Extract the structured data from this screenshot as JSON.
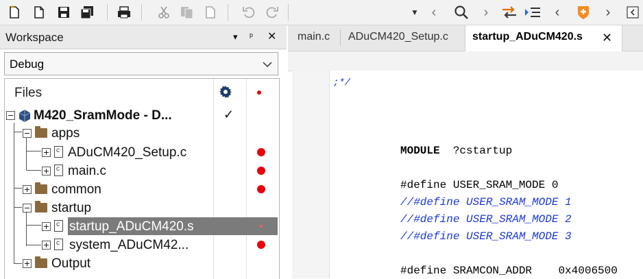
{
  "workspace": {
    "title": "Workspace",
    "pin": "▾",
    "pin2": "ᵖ",
    "close": "✕",
    "config": "Debug",
    "files_header": "Files"
  },
  "tree": {
    "project": "M420_SramMode - D...",
    "project_check": "✓",
    "apps": "apps",
    "setup_file": "ADuCM420_Setup.c",
    "main_file": "main.c",
    "common": "common",
    "startup": "startup",
    "startup_file": "startup_ADuCM420.s",
    "system_file": "system_ADuCM42...",
    "output": "Output"
  },
  "tabs": {
    "tab1": "main.c",
    "tab2": "ADuCM420_Setup.c",
    "active": "startup_ADuCM420.s",
    "close": "✕"
  },
  "code": {
    "line1": ";*/",
    "line2": "MODULE  ?cstartup",
    "line3": "#define USER_SRAM_MODE 0",
    "line4": "//#define USER_SRAM_MODE 1",
    "line5": "//#define USER_SRAM_MODE 2",
    "line6": "//#define USER_SRAM_MODE 3",
    "line7": "#define SRAMCON_ADDR    0x4006500"
  },
  "icons": {
    "new": "new-file-icon",
    "open": "open-file-icon",
    "save": "save-icon",
    "save_all": "save-all-icon",
    "print": "print-icon",
    "cut": "cut-icon",
    "copy": "copy-icon",
    "paste": "paste-icon",
    "undo": "undo-icon",
    "redo": "redo-icon"
  },
  "colors": {
    "breakpoint": "#e8000b",
    "comment": "#1c38d8",
    "selection": "#7b7b7b",
    "folder": "#8a6a3c"
  }
}
